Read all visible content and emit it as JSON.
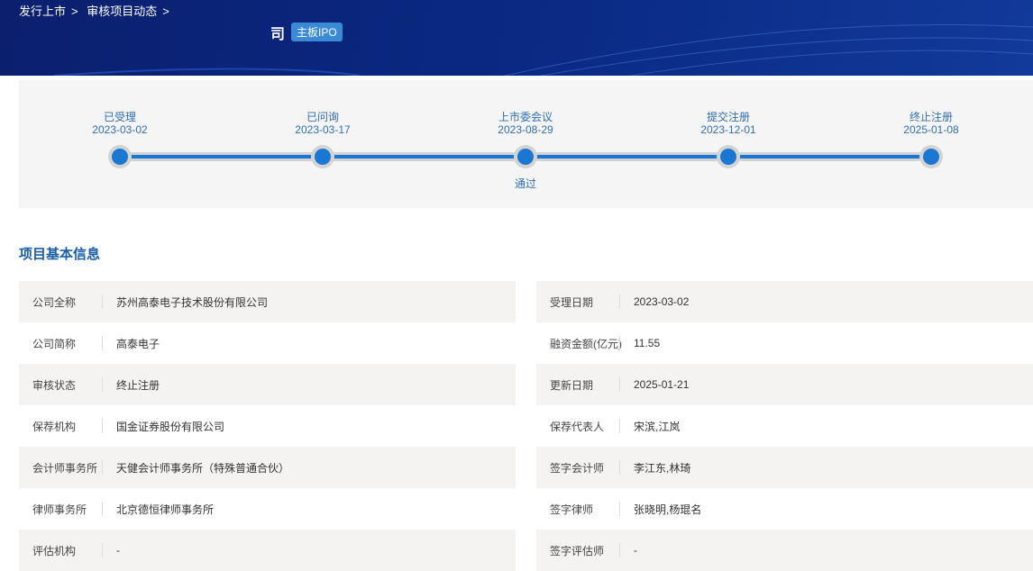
{
  "breadcrumb": [
    "发行上市",
    "审核项目动态"
  ],
  "title_fragment": "司",
  "badge": "主板IPO",
  "timeline": [
    {
      "label": "已受理",
      "date": "2023-03-02",
      "note": ""
    },
    {
      "label": "已问询",
      "date": "2023-03-17",
      "note": ""
    },
    {
      "label": "上市委会议",
      "date": "2023-08-29",
      "note": "通过"
    },
    {
      "label": "提交注册",
      "date": "2023-12-01",
      "note": ""
    },
    {
      "label": "终止注册",
      "date": "2025-01-08",
      "note": ""
    }
  ],
  "section_title": "项目基本信息",
  "left": [
    {
      "label": "公司全称",
      "value": "苏州高泰电子技术股份有限公司"
    },
    {
      "label": "公司简称",
      "value": "高泰电子"
    },
    {
      "label": "审核状态",
      "value": "终止注册"
    },
    {
      "label": "保荐机构",
      "value": "国金证券股份有限公司"
    },
    {
      "label": "会计师事务所",
      "value": "天健会计师事务所（特殊普通合伙）"
    },
    {
      "label": "律师事务所",
      "value": "北京德恒律师事务所"
    },
    {
      "label": "评估机构",
      "value": "-"
    }
  ],
  "right": [
    {
      "label": "受理日期",
      "value": "2023-03-02"
    },
    {
      "label": "融资金额(亿元)",
      "value": "11.55"
    },
    {
      "label": "更新日期",
      "value": "2025-01-21"
    },
    {
      "label": "保荐代表人",
      "value": "宋滨,江岚"
    },
    {
      "label": "签字会计师",
      "value": "李江东,林琦"
    },
    {
      "label": "签字律师",
      "value": "张晓明,杨琨名"
    },
    {
      "label": "签字评估师",
      "value": "-"
    }
  ]
}
